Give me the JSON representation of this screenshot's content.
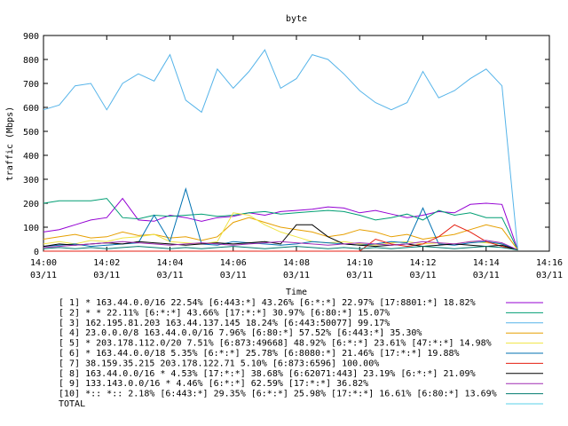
{
  "chart_data": {
    "type": "line",
    "title": "byte",
    "xlabel": "Time",
    "ylabel": "traffic (Mbps)",
    "ylim": [
      0,
      900
    ],
    "y_ticks": [
      0,
      100,
      200,
      300,
      400,
      500,
      600,
      700,
      800,
      900
    ],
    "x_ticks": [
      {
        "time": "14:00",
        "date": "03/11"
      },
      {
        "time": "14:02",
        "date": "03/11"
      },
      {
        "time": "14:04",
        "date": "03/11"
      },
      {
        "time": "14:06",
        "date": "03/11"
      },
      {
        "time": "14:08",
        "date": "03/11"
      },
      {
        "time": "14:10",
        "date": "03/11"
      },
      {
        "time": "14:12",
        "date": "03/11"
      },
      {
        "time": "14:14",
        "date": "03/11"
      },
      {
        "time": "14:16",
        "date": "03/11"
      }
    ],
    "x_minutes": [
      0,
      0.5,
      1,
      1.5,
      2,
      2.5,
      3,
      3.5,
      4,
      4.5,
      5,
      5.5,
      6,
      6.5,
      7,
      7.5,
      8,
      8.5,
      9,
      9.5,
      10,
      10.5,
      11,
      11.5,
      12,
      12.5,
      13,
      13.5,
      14,
      14.5,
      15
    ],
    "grid": false,
    "legend_position": "bottom",
    "series": [
      {
        "name": "[ 1] * 163.44.0.0/16 22.54%  [6:443:*] 43.26% [6:*:*] 22.97% [17:8801:*] 18.82%",
        "color": "#9400d3",
        "values": [
          80,
          90,
          110,
          130,
          140,
          220,
          130,
          125,
          150,
          140,
          125,
          140,
          145,
          160,
          150,
          165,
          170,
          175,
          185,
          180,
          160,
          170,
          155,
          140,
          150,
          165,
          160,
          195,
          200,
          195,
          5
        ]
      },
      {
        "name": "[ 2] * * 22.11%  [6:*:*] 43.66% [17:*:*] 30.97% [6:80:*] 15.07%",
        "color": "#009e73",
        "values": [
          200,
          210,
          210,
          210,
          220,
          140,
          135,
          150,
          145,
          150,
          155,
          145,
          150,
          160,
          165,
          155,
          160,
          165,
          170,
          165,
          150,
          130,
          140,
          155,
          130,
          170,
          150,
          160,
          140,
          140,
          5
        ]
      },
      {
        "name": "[ 3] 162.195.81.203 163.44.137.145 18.24%  [6:443:50077] 99.17%",
        "color": "#56b4e9",
        "values": [
          590,
          610,
          690,
          700,
          590,
          700,
          740,
          710,
          820,
          630,
          580,
          760,
          680,
          750,
          840,
          680,
          720,
          820,
          800,
          740,
          670,
          620,
          590,
          620,
          750,
          640,
          670,
          720,
          760,
          690,
          5
        ]
      },
      {
        "name": "[ 4] 23.0.0.0/8 163.44.0.0/16 7.96%  [6:80:*] 57.52% [6:443:*] 35.30%",
        "color": "#e69f00",
        "values": [
          50,
          60,
          70,
          55,
          60,
          80,
          65,
          70,
          55,
          60,
          45,
          60,
          120,
          140,
          120,
          100,
          90,
          80,
          60,
          70,
          90,
          80,
          60,
          70,
          50,
          60,
          70,
          90,
          110,
          95,
          5
        ]
      },
      {
        "name": "[ 5] * 203.178.112.0/20 7.51%  [6:873:49668] 48.92% [6:*:*] 23.61% [47:*:*] 14.98%",
        "color": "#f0e442",
        "values": [
          30,
          40,
          30,
          45,
          40,
          55,
          60,
          70,
          40,
          35,
          30,
          40,
          160,
          150,
          110,
          80,
          60,
          40,
          35,
          40,
          30,
          25,
          35,
          40,
          30,
          35,
          30,
          40,
          35,
          30,
          5
        ]
      },
      {
        "name": "[ 6] * 163.44.0.0/18 5.35%  [6:*:*] 25.78% [6:8080:*] 21.46% [17:*:*] 19.88%",
        "color": "#0072b2",
        "values": [
          20,
          25,
          30,
          20,
          25,
          30,
          35,
          150,
          40,
          260,
          30,
          25,
          40,
          35,
          30,
          25,
          30,
          40,
          35,
          30,
          25,
          30,
          40,
          35,
          180,
          30,
          25,
          35,
          40,
          30,
          5
        ]
      },
      {
        "name": "[ 7] 38.159.35.215 203.178.122.71 5.10%  [6:873:6596] 100.00%",
        "color": "#e51e10",
        "values": [
          0,
          0,
          0,
          0,
          0,
          0,
          0,
          0,
          0,
          0,
          0,
          0,
          0,
          0,
          0,
          0,
          0,
          0,
          0,
          0,
          0,
          50,
          30,
          20,
          30,
          60,
          110,
          80,
          40,
          20,
          5
        ]
      },
      {
        "name": "[ 8] 163.44.0.0/16 * 4.53%  [17:*:*] 38.68% [6:62071:443] 23.19% [6:*:*] 21.09%",
        "color": "#000000",
        "values": [
          20,
          30,
          25,
          30,
          35,
          30,
          40,
          35,
          30,
          25,
          30,
          35,
          30,
          35,
          40,
          30,
          110,
          110,
          60,
          30,
          25,
          20,
          25,
          30,
          20,
          25,
          30,
          25,
          20,
          25,
          5
        ]
      },
      {
        "name": "[ 9] 133.143.0.0/16 * 4.46%  [6:*:*] 62.59% [17:*:*] 36.82%",
        "color": "#9f2bb3",
        "values": [
          15,
          20,
          25,
          30,
          35,
          40,
          35,
          30,
          25,
          30,
          35,
          30,
          25,
          30,
          35,
          40,
          35,
          30,
          25,
          30,
          35,
          30,
          25,
          30,
          40,
          35,
          30,
          40,
          45,
          35,
          5
        ]
      },
      {
        "name": "[10] *:: *:: 2.18%  [6:443:*] 29.35% [6:*:*] 25.98% [17:*:*] 16.61% [6:80:*] 13.69%",
        "color": "#007a6e",
        "values": [
          10,
          15,
          10,
          15,
          10,
          15,
          20,
          15,
          10,
          15,
          10,
          15,
          20,
          15,
          10,
          15,
          20,
          15,
          10,
          15,
          10,
          15,
          10,
          15,
          20,
          15,
          10,
          15,
          20,
          15,
          5
        ]
      },
      {
        "name": "TOTAL",
        "color": "#5ad0e8",
        "values": []
      }
    ]
  }
}
